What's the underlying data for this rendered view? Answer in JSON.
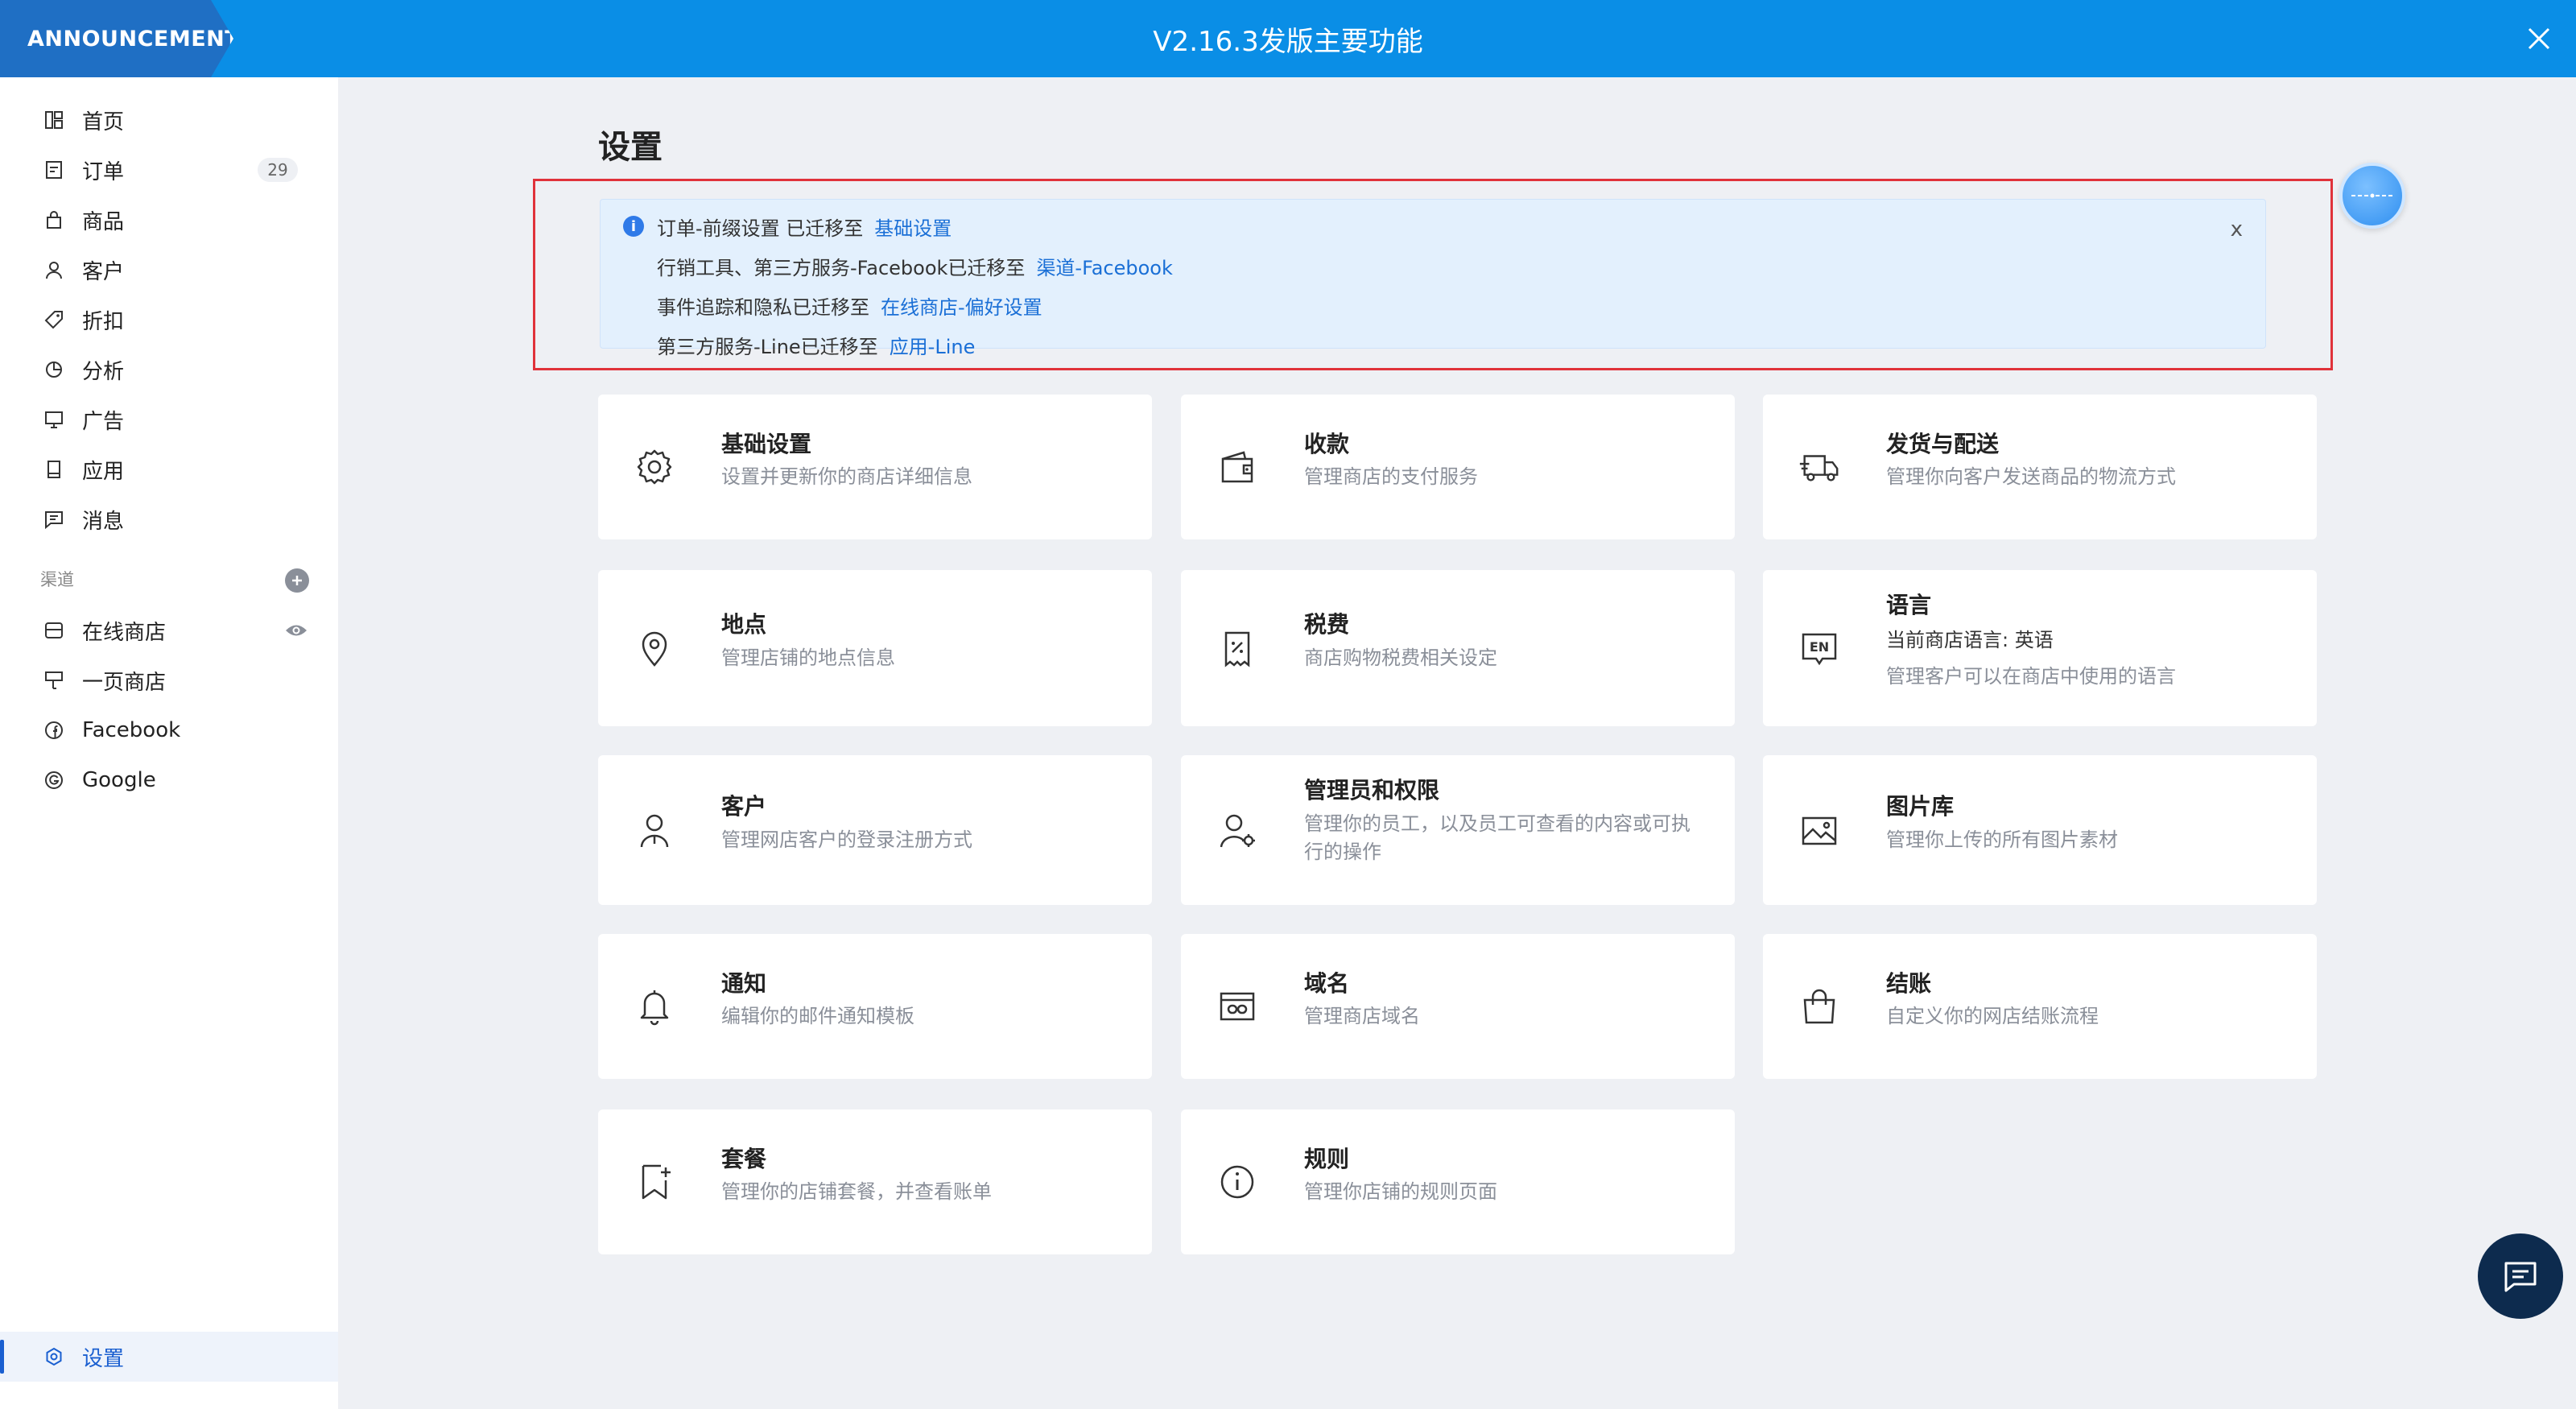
{
  "announcement": {
    "tag": "ANNOUNCEMENT",
    "title": "V2.16.3发版主要功能"
  },
  "sidebar": {
    "items": [
      {
        "label": "首页",
        "icon": "dashboard-icon"
      },
      {
        "label": "订单",
        "icon": "order-icon",
        "badge": "29"
      },
      {
        "label": "商品",
        "icon": "bag-icon"
      },
      {
        "label": "客户",
        "icon": "user-icon"
      },
      {
        "label": "折扣",
        "icon": "tag-icon"
      },
      {
        "label": "分析",
        "icon": "pie-chart-icon"
      },
      {
        "label": "广告",
        "icon": "monitor-icon"
      },
      {
        "label": "应用",
        "icon": "tablet-icon"
      },
      {
        "label": "消息",
        "icon": "message-icon"
      }
    ],
    "channels_label": "渠道",
    "channels": [
      {
        "label": "在线商店",
        "icon": "store-icon"
      },
      {
        "label": "一页商店",
        "icon": "landing-page-icon"
      },
      {
        "label": "Facebook",
        "icon": "facebook-icon"
      },
      {
        "label": "Google",
        "icon": "google-icon"
      }
    ],
    "settings_label": "设置"
  },
  "page": {
    "title": "设置"
  },
  "notice": {
    "lines": [
      {
        "text": "订单-前缀设置 已迁移至",
        "link": "基础设置"
      },
      {
        "text": "行销工具、第三方服务-Facebook已迁移至",
        "link": "渠道-Facebook"
      },
      {
        "text": "事件追踪和隐私已迁移至",
        "link": "在线商店-偏好设置"
      },
      {
        "text": "第三方服务-Line已迁移至",
        "link": "应用-Line"
      }
    ],
    "close": "x"
  },
  "cards": [
    {
      "title": "基础设置",
      "desc": "设置并更新你的商店详细信息",
      "icon": "gear-icon"
    },
    {
      "title": "收款",
      "desc": "管理商店的支付服务",
      "icon": "wallet-icon"
    },
    {
      "title": "发货与配送",
      "desc": "管理你向客户发送商品的物流方式",
      "icon": "truck-icon"
    },
    {
      "title": "地点",
      "desc": "管理店铺的地点信息",
      "icon": "location-pin-icon"
    },
    {
      "title": "税费",
      "desc": "商店购物税费相关设定",
      "icon": "receipt-icon"
    },
    {
      "title": "语言",
      "desc": "当前商店语言: 英语",
      "desc2": "管理客户可以在商店中使用的语言",
      "icon": "language-en-icon"
    },
    {
      "title": "客户",
      "desc": "管理网店客户的登录注册方式",
      "icon": "customer-icon"
    },
    {
      "title": "管理员和权限",
      "desc": "管理你的员工，以及员工可查看的内容或可执行的操作",
      "icon": "staff-permission-icon"
    },
    {
      "title": "图片库",
      "desc": "管理你上传的所有图片素材",
      "icon": "image-icon"
    },
    {
      "title": "通知",
      "desc": "编辑你的邮件通知模板",
      "icon": "bell-icon"
    },
    {
      "title": "域名",
      "desc": "管理商店域名",
      "icon": "domain-icon"
    },
    {
      "title": "结账",
      "desc": "自定义你的网店结账流程",
      "icon": "shopping-bag-icon"
    },
    {
      "title": "套餐",
      "desc": "管理你的店铺套餐，并查看账单",
      "icon": "bookmark-plus-icon"
    },
    {
      "title": "规则",
      "desc": "管理你店铺的规则页面",
      "icon": "info-circle-icon"
    }
  ]
}
